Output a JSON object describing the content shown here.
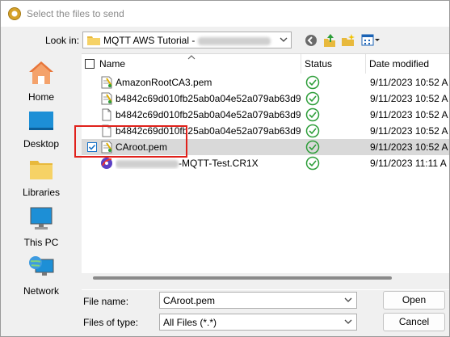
{
  "window": {
    "title": "Select the files to send"
  },
  "toolbar": {
    "lookin_label": "Look in:",
    "lookin_value": "MQTT AWS Tutorial -"
  },
  "places": [
    {
      "label": "Home",
      "icon": "home-icon"
    },
    {
      "label": "Desktop",
      "icon": "desktop-icon"
    },
    {
      "label": "Libraries",
      "icon": "libraries-icon"
    },
    {
      "label": "This PC",
      "icon": "this-pc-icon"
    },
    {
      "label": "Network",
      "icon": "network-icon"
    }
  ],
  "columns": {
    "name": "Name",
    "status": "Status",
    "date": "Date modified"
  },
  "files": [
    {
      "name": "AmazonRootCA3.pem",
      "date": "9/11/2023 10:52 A",
      "icon": "certificate-file-icon",
      "selected": false
    },
    {
      "name": "b4842c69d010fb25ab0a04e52a079ab63d9...",
      "date": "9/11/2023 10:52 A",
      "icon": "certificate-file-icon",
      "selected": false
    },
    {
      "name": "b4842c69d010fb25ab0a04e52a079ab63d9...",
      "date": "9/11/2023 10:52 A",
      "icon": "blank-file-icon",
      "selected": false
    },
    {
      "name": "b4842c69d010fb25ab0a04e52a079ab63d9...",
      "date": "9/11/2023 10:52 A",
      "icon": "blank-file-icon",
      "selected": false
    },
    {
      "name": "CAroot.pem",
      "date": "9/11/2023 10:52 A",
      "icon": "certificate-file-icon",
      "selected": true
    },
    {
      "name": "-MQTT-Test.CR1X",
      "date": "9/11/2023 11:11 A",
      "icon": "app-file-icon",
      "selected": false
    }
  ],
  "footer": {
    "filename_label": "File name:",
    "filename_value": "CAroot.pem",
    "filetype_label": "Files of type:",
    "filetype_value": "All Files (*.*)",
    "open_label": "Open",
    "cancel_label": "Cancel"
  },
  "colors": {
    "accent": "#1a73c8",
    "highlight": "#e0211b",
    "status_green": "#2e9e3a"
  }
}
